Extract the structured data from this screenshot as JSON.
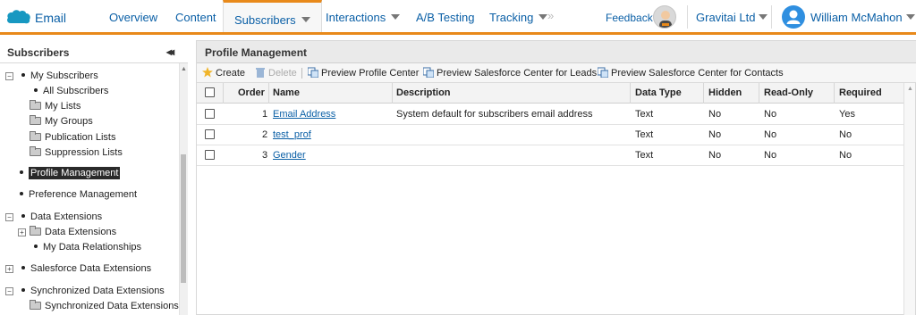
{
  "topnav": {
    "app_title": "Email",
    "tabs": [
      {
        "label": "Overview"
      },
      {
        "label": "Content"
      },
      {
        "label": "Subscribers"
      },
      {
        "label": "Interactions"
      },
      {
        "label": "A/B Testing"
      },
      {
        "label": "Tracking"
      }
    ],
    "more_glyph": "»",
    "feedback": "Feedback",
    "org": "Gravitai Ltd",
    "user": "William McMahon",
    "colors": {
      "accent": "#e8891a",
      "link": "#0a5fa6",
      "logo": "#1798c1"
    }
  },
  "sidebar": {
    "title": "Subscribers",
    "collapse_glyph": "◂◂",
    "tree": [
      {
        "label": "My Subscribers",
        "expander": "−"
      },
      {
        "label": "All Subscribers"
      },
      {
        "label": "My Lists"
      },
      {
        "label": "My Groups"
      },
      {
        "label": "Publication Lists"
      },
      {
        "label": "Suppression Lists"
      },
      {
        "label": "Profile Management",
        "selected": true
      },
      {
        "label": "Preference Management"
      },
      {
        "label": "Data Extensions",
        "expander": "−"
      },
      {
        "label": "Data Extensions",
        "expander": "+"
      },
      {
        "label": "My Data Relationships"
      },
      {
        "label": "Salesforce Data Extensions",
        "expander": "+"
      },
      {
        "label": "Synchronized Data Extensions",
        "expander": "−"
      },
      {
        "label": "Synchronized Data Extensions"
      }
    ]
  },
  "main": {
    "title": "Profile Management",
    "toolbar": {
      "create": "Create",
      "delete": "Delete",
      "preview_profile": "Preview Profile Center",
      "preview_leads": "Preview Salesforce Center for Leads",
      "preview_contacts": "Preview Salesforce Center for Contacts"
    },
    "columns": {
      "order": "Order",
      "name": "Name",
      "description": "Description",
      "data_type": "Data Type",
      "hidden": "Hidden",
      "read_only": "Read-Only",
      "required": "Required"
    },
    "rows": [
      {
        "order": "1",
        "name": "Email Address",
        "description": "System default for subscribers email address",
        "data_type": "Text",
        "hidden": "No",
        "read_only": "No",
        "required": "Yes"
      },
      {
        "order": "2",
        "name": "test_prof",
        "description": "",
        "data_type": "Text",
        "hidden": "No",
        "read_only": "No",
        "required": "No"
      },
      {
        "order": "3",
        "name": "Gender",
        "description": "",
        "data_type": "Text",
        "hidden": "No",
        "read_only": "No",
        "required": "No"
      }
    ]
  }
}
